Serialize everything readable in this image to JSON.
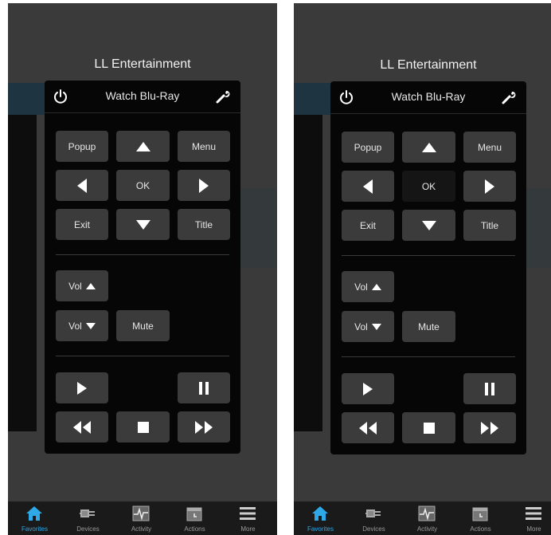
{
  "app": {
    "title": "LL Entertainment"
  },
  "remote": {
    "activity": "Watch Blu-Ray",
    "dpad": {
      "popup": "Popup",
      "menu": "Menu",
      "ok": "OK",
      "exit": "Exit",
      "title": "Title"
    },
    "volume": {
      "vol_up": "Vol",
      "vol_down": "Vol",
      "mute": "Mute"
    }
  },
  "tabs": [
    {
      "label": "Favorites",
      "icon": "home-icon",
      "active": true
    },
    {
      "label": "Devices",
      "icon": "plug-icon"
    },
    {
      "label": "Activity",
      "icon": "pulse-icon"
    },
    {
      "label": "Actions",
      "icon": "calendar-icon"
    },
    {
      "label": "More",
      "icon": "menu-icon"
    }
  ],
  "colors": {
    "accent": "#2ea8e6",
    "panel": "#060606",
    "button": "#3b3b3b",
    "backdrop": "#3a3a3a"
  }
}
